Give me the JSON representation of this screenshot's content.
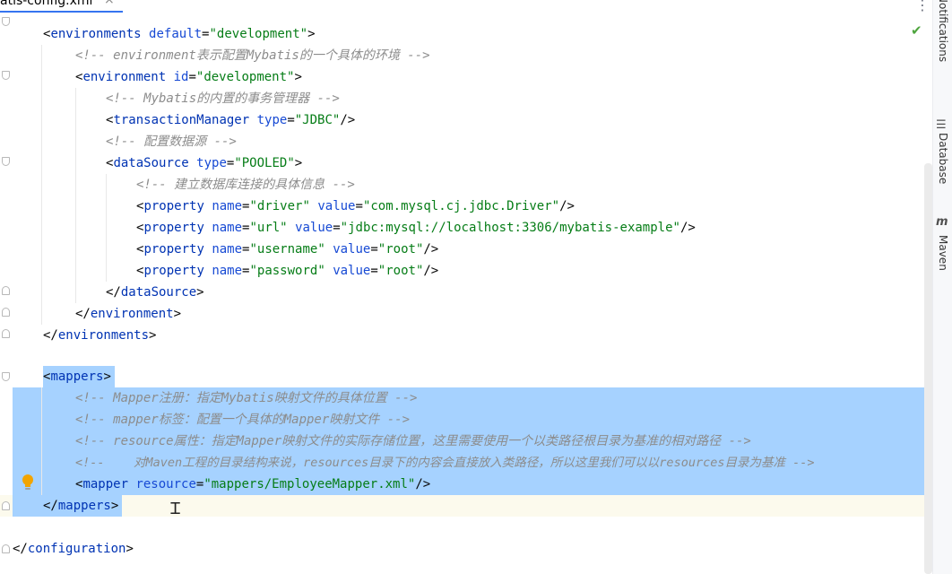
{
  "tab": {
    "filename": "atis-config.xml",
    "close_glyph": "×",
    "more_glyph": "⋮"
  },
  "editor": {
    "lines": {
      "l1": {
        "open": "<",
        "tag": "environments",
        "attr1": "default",
        "eq": "=",
        "val1": "\"development\"",
        "close": ">"
      },
      "l2": {
        "comment": "<!-- environment表示配置Mybatis的一个具体的环境 -->"
      },
      "l3": {
        "open": "<",
        "tag": "environment",
        "attr1": "id",
        "eq": "=",
        "val1": "\"development\"",
        "close": ">"
      },
      "l4": {
        "comment": "<!-- Mybatis的内置的事务管理器 -->"
      },
      "l5": {
        "open": "<",
        "tag": "transactionManager",
        "attr1": "type",
        "eq": "=",
        "val1": "\"JDBC\"",
        "close": "/>"
      },
      "l6": {
        "comment": "<!-- 配置数据源 -->"
      },
      "l7": {
        "open": "<",
        "tag": "dataSource",
        "attr1": "type",
        "eq": "=",
        "val1": "\"POOLED\"",
        "close": ">"
      },
      "l8": {
        "comment": "<!-- 建立数据库连接的具体信息 -->"
      },
      "l9": {
        "open": "<",
        "tag": "property",
        "attr1": "name",
        "eq": "=",
        "val1": "\"driver\"",
        "attr2": "value",
        "val2": "\"com.mysql.cj.jdbc.Driver\"",
        "close": "/>"
      },
      "l10": {
        "open": "<",
        "tag": "property",
        "attr1": "name",
        "eq": "=",
        "val1": "\"url\"",
        "attr2": "value",
        "val2": "\"jdbc:mysql://localhost:3306/mybatis-example\"",
        "close": "/>"
      },
      "l11": {
        "open": "<",
        "tag": "property",
        "attr1": "name",
        "eq": "=",
        "val1": "\"username\"",
        "attr2": "value",
        "val2": "\"root\"",
        "close": "/>"
      },
      "l12": {
        "open": "<",
        "tag": "property",
        "attr1": "name",
        "eq": "=",
        "val1": "\"password\"",
        "attr2": "value",
        "val2": "\"root\"",
        "close": "/>"
      },
      "l13": {
        "open": "</",
        "tag": "dataSource",
        "close": ">"
      },
      "l14": {
        "open": "</",
        "tag": "environment",
        "close": ">"
      },
      "l15": {
        "open": "</",
        "tag": "environments",
        "close": ">"
      },
      "l16": {
        "open": "<",
        "tag": "mappers",
        "close": ">"
      },
      "l17": {
        "comment": "<!-- Mapper注册：指定Mybatis映射文件的具体位置 -->"
      },
      "l18": {
        "comment": "<!-- mapper标签：配置一个具体的Mapper映射文件 -->"
      },
      "l19": {
        "comment": "<!-- resource属性：指定Mapper映射文件的实际存储位置，这里需要使用一个以类路径根目录为基准的相对路径 -->"
      },
      "l20": {
        "comment": "<!--    对Maven工程的目录结构来说，resources目录下的内容会直接放入类路径，所以这里我们可以以resources目录为基准 -->"
      },
      "l21": {
        "open": "<",
        "tag": "mapper",
        "attr1": "resource",
        "eq": "=",
        "val1": "\"mappers/EmployeeMapper.xml\"",
        "close": "/>"
      },
      "l22": {
        "open": "</",
        "tag": "mappers",
        "close": ">"
      },
      "l23": {
        "open": "</",
        "tag": "configuration",
        "close": ">"
      }
    }
  },
  "colors": {
    "tag": "#0033b3",
    "attribute": "#174ad4",
    "value": "#067d17",
    "comment": "#8c8c8c",
    "selection": "#a6d2ff",
    "caret_line": "#fcfaed",
    "check": "#4ea53e",
    "bulb": "#f2a400"
  },
  "status": {
    "inspection_icon": "check-icon"
  },
  "tool_window_strip": {
    "items": [
      {
        "label": "Notifications",
        "icon": "bell-icon"
      },
      {
        "label": "Database",
        "icon": "database-icon"
      },
      {
        "label": "Maven",
        "icon": "maven-icon",
        "glyph": "m"
      }
    ]
  }
}
